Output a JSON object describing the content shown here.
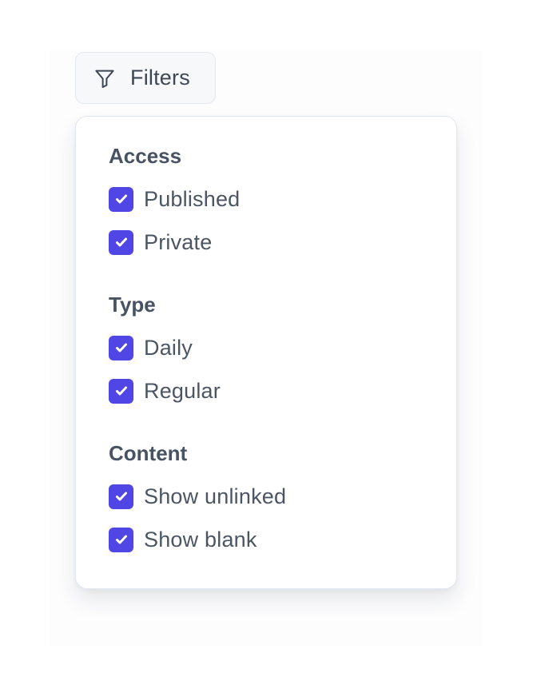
{
  "filters_button": {
    "label": "Filters",
    "icon": "funnel-icon"
  },
  "panel": {
    "groups": [
      {
        "heading": "Access",
        "options": [
          {
            "label": "Published",
            "checked": true
          },
          {
            "label": "Private",
            "checked": true
          }
        ]
      },
      {
        "heading": "Type",
        "options": [
          {
            "label": "Daily",
            "checked": true
          },
          {
            "label": "Regular",
            "checked": true
          }
        ]
      },
      {
        "heading": "Content",
        "options": [
          {
            "label": "Show unlinked",
            "checked": true
          },
          {
            "label": "Show blank",
            "checked": true
          }
        ]
      }
    ]
  },
  "colors": {
    "accent": "#4f46e5",
    "text": "#4b5563",
    "heading": "#475263",
    "button_bg": "#f6f8fa",
    "border": "#e2e6f0"
  }
}
